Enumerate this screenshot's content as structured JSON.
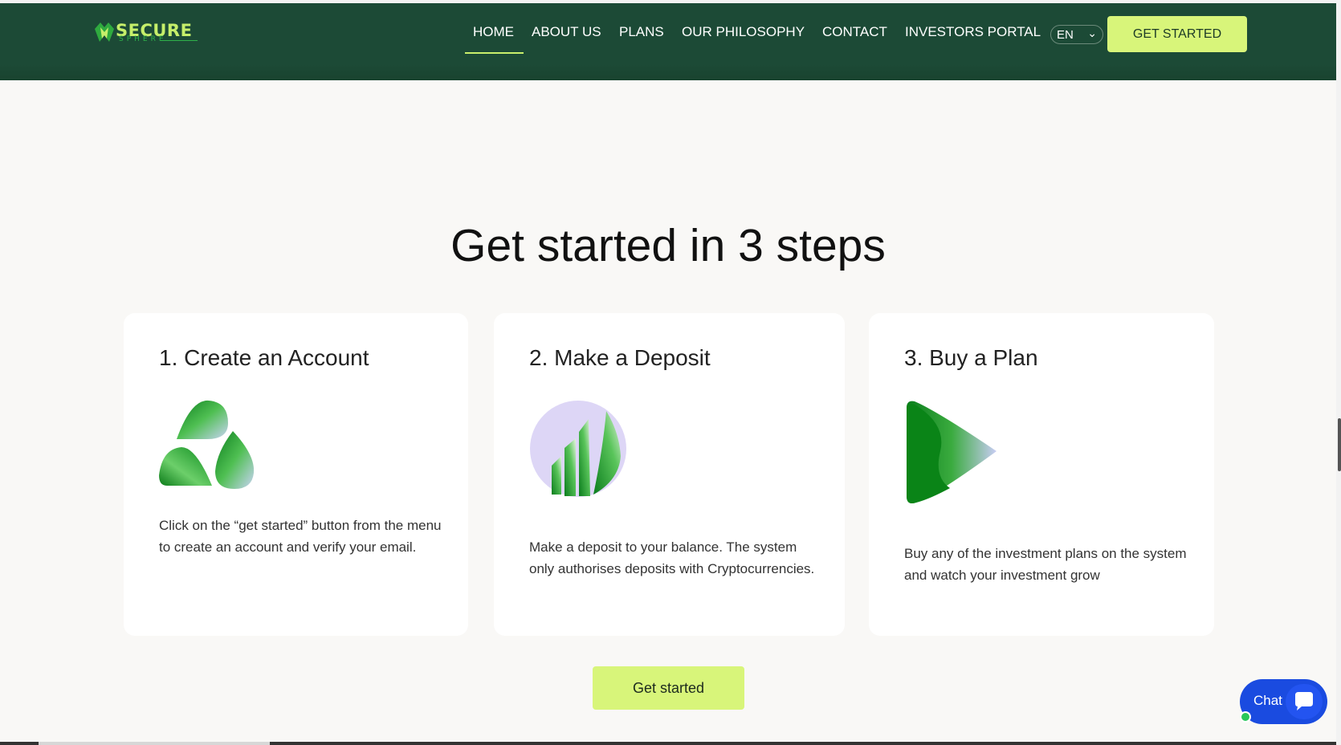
{
  "header": {
    "logo_text": "SECURE",
    "logo_subtext": "SPHERE",
    "nav": [
      {
        "label": "HOME",
        "active": true
      },
      {
        "label": "ABOUT US"
      },
      {
        "label": "PLANS"
      },
      {
        "label": "OUR PHILOSOPHY"
      },
      {
        "label": "CONTACT"
      },
      {
        "label": "INVESTORS PORTAL"
      }
    ],
    "language": {
      "selected": "EN"
    },
    "cta_label": "GET STARTED"
  },
  "section": {
    "title": "Get started in 3 steps",
    "steps": [
      {
        "title": "1. Create an Account",
        "text": "Click on the “get started” button from the menu to create an account and verify your email.",
        "icon": "recycle-shapes-icon"
      },
      {
        "title": "2. Make a Deposit",
        "text": "Make a deposit to your balance. The system only authorises deposits with Cryptocurrencies.",
        "icon": "deposit-chart-icon"
      },
      {
        "title": "3. Buy a Plan",
        "text": "Buy any of the investment plans on the system and watch your investment grow",
        "icon": "play-arrow-icon"
      }
    ],
    "cta_label": "Get started"
  },
  "chat_widget": {
    "label": "Chat",
    "icon": "chat-bubble-icon"
  },
  "colors": {
    "header_bg": "#1c4a36",
    "accent": "#d8f57a",
    "chat_blue": "#1a4be0",
    "page_bg": "#f9f8f6"
  }
}
